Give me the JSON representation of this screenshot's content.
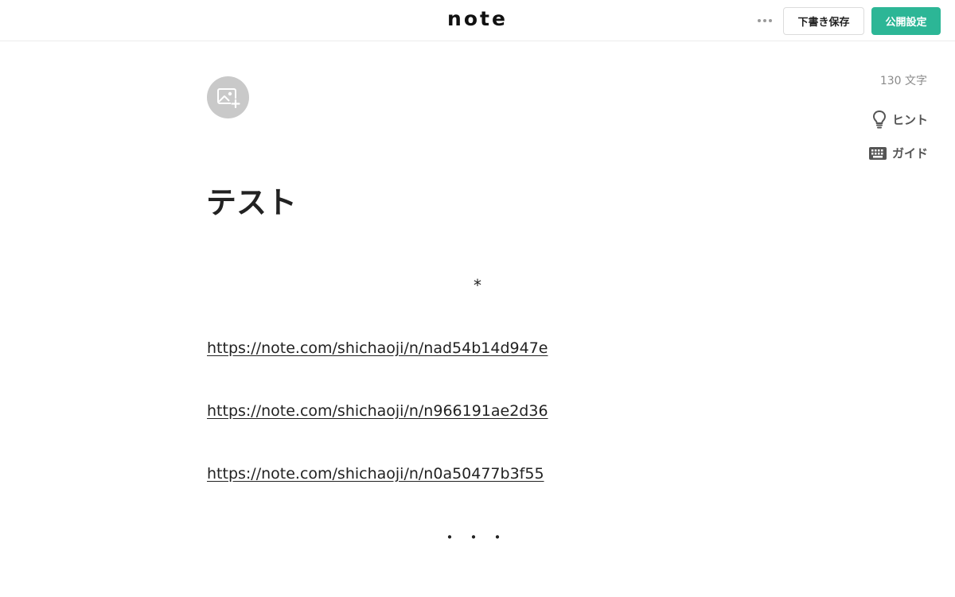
{
  "header": {
    "logo": "note",
    "more_icon": "more-horizontal-icon",
    "draft_save_label": "下書き保存",
    "publish_settings_label": "公開設定",
    "accent_color": "#2cb696"
  },
  "sidebar": {
    "char_count": "130 文字",
    "hint_label": "ヒント",
    "hint_icon": "lightbulb-icon",
    "guide_label": "ガイド",
    "guide_icon": "keyboard-icon"
  },
  "editor": {
    "image_icon": "add-image-icon",
    "title": "テスト",
    "separator_top": "*",
    "links": [
      "https://note.com/shichaoji/n/nad54b14d947e",
      "https://note.com/shichaoji/n/n966191ae2d36",
      "https://note.com/shichaoji/n/n0a50477b3f55"
    ],
    "separator_bottom": "・・・"
  }
}
